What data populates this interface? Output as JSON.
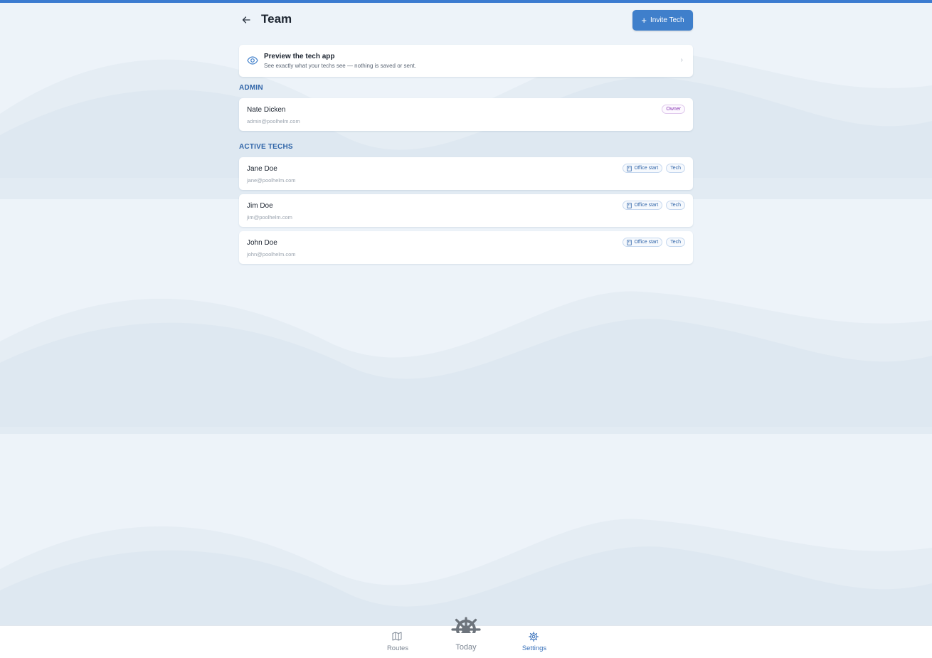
{
  "header": {
    "title": "Team",
    "invite_label": "Invite Tech",
    "back_icon": "arrow-left-icon",
    "invite_icon": "plus-icon"
  },
  "preview": {
    "title": "Preview the tech app",
    "subtitle": "See exactly what your techs see — nothing is saved or sent.",
    "icon": "eye-icon"
  },
  "sections": {
    "admin_label": "ADMIN",
    "techs_label": "ACTIVE TECHS"
  },
  "admin": {
    "name": "Nate Dicken",
    "email": "admin@poolhelm.com",
    "role": "Owner"
  },
  "techs": [
    {
      "name": "Jane Doe",
      "email": "jane@poolhelm.com",
      "start": "Office start",
      "role": "Tech"
    },
    {
      "name": "Jim Doe",
      "email": "jim@poolhelm.com",
      "start": "Office start",
      "role": "Tech"
    },
    {
      "name": "John Doe",
      "email": "john@poolhelm.com",
      "start": "Office start",
      "role": "Tech"
    }
  ],
  "nav": {
    "routes": "Routes",
    "today": "Today",
    "settings": "Settings",
    "active": "Settings"
  },
  "colors": {
    "accent": "#3f7fcb",
    "section": "#2f64a8",
    "owner_badge": "#8a3bb4",
    "background": "#edf3f9"
  }
}
